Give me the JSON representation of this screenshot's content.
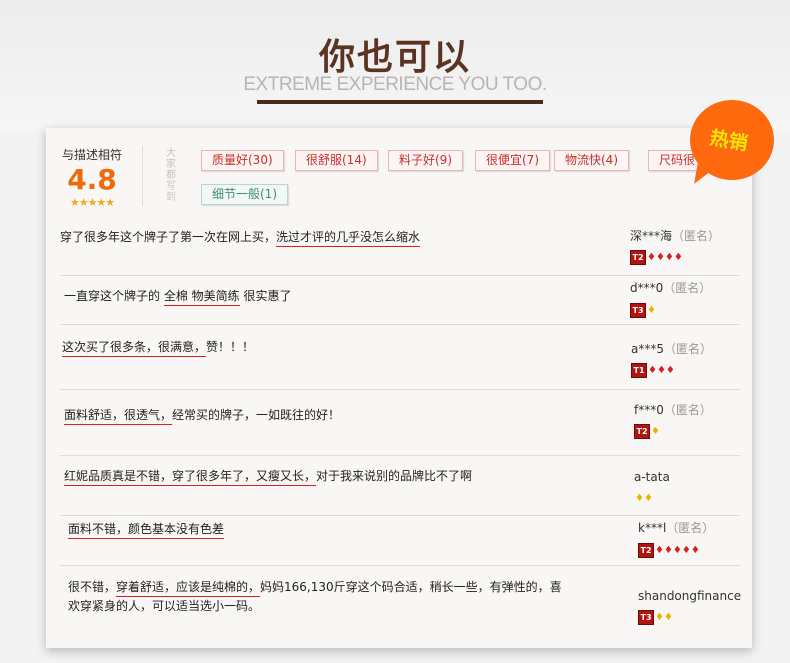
{
  "header": {
    "title": "你也可以",
    "subtitle": "EXTREME EXPERIENCE YOU TOO."
  },
  "badge": {
    "text": "热销"
  },
  "summary": {
    "label": "与描述相符",
    "score": "4.8",
    "stars": "★★★★★",
    "tags_label": "大家都写到"
  },
  "tags": [
    {
      "text": "质量好(30)",
      "type": "positive"
    },
    {
      "text": "很舒服(14)",
      "type": "positive"
    },
    {
      "text": "料子好(9)",
      "type": "positive"
    },
    {
      "text": "很便宜(7)",
      "type": "positive"
    },
    {
      "text": "物流快(4)",
      "type": "positive"
    },
    {
      "text": "尺码很",
      "type": "positive"
    },
    {
      "text": "细节一般(1)",
      "type": "neutral"
    }
  ],
  "reviews": [
    {
      "parts": [
        "穿了很多年这个牌子了第一次在网上买，",
        "洗过才评的几乎没怎么缩水",
        ""
      ],
      "user": "深***海",
      "anon": "（匿名）",
      "level": "T2",
      "gems": "♦♦♦♦"
    },
    {
      "parts": [
        "一直穿这个牌子的 ",
        "全棉 物美简练",
        " 很实惠了"
      ],
      "user": "d***0",
      "anon": "（匿名）",
      "level": "T3",
      "gems": "♦"
    },
    {
      "parts": [
        "",
        "这次买了很多条，很满意，",
        "赞！！！"
      ],
      "user": "a***5",
      "anon": "（匿名）",
      "level": "T1",
      "gems": "♦♦♦"
    },
    {
      "parts": [
        "",
        "面料舒适，很透气，",
        "经常买的牌子，一如既往的好！"
      ],
      "user": "f***0",
      "anon": "（匿名）",
      "level": "T2",
      "gems": "♦"
    },
    {
      "parts": [
        "",
        "红妮品质真是不错，穿了很多年了，又瘦又长，",
        "对于我来说别的品牌比不了啊"
      ],
      "user": "a-tata",
      "anon": "",
      "level": "",
      "gems": "♦♦"
    },
    {
      "parts": [
        "",
        "面料不错，颜色基本没有色差",
        ""
      ],
      "user": "k***l",
      "anon": "（匿名）",
      "level": "T2",
      "gems": "♦♦♦♦♦"
    },
    {
      "parts": [
        "很不错，",
        "穿着舒适，应该是纯棉的，",
        "妈妈166,130斤穿这个码合适，稍长一些，有弹性的，喜欢穿紧身的人，可以适当选小一码。"
      ],
      "user": "shandongfinance",
      "anon": "",
      "level": "T3",
      "gems": "♦♦"
    }
  ]
}
